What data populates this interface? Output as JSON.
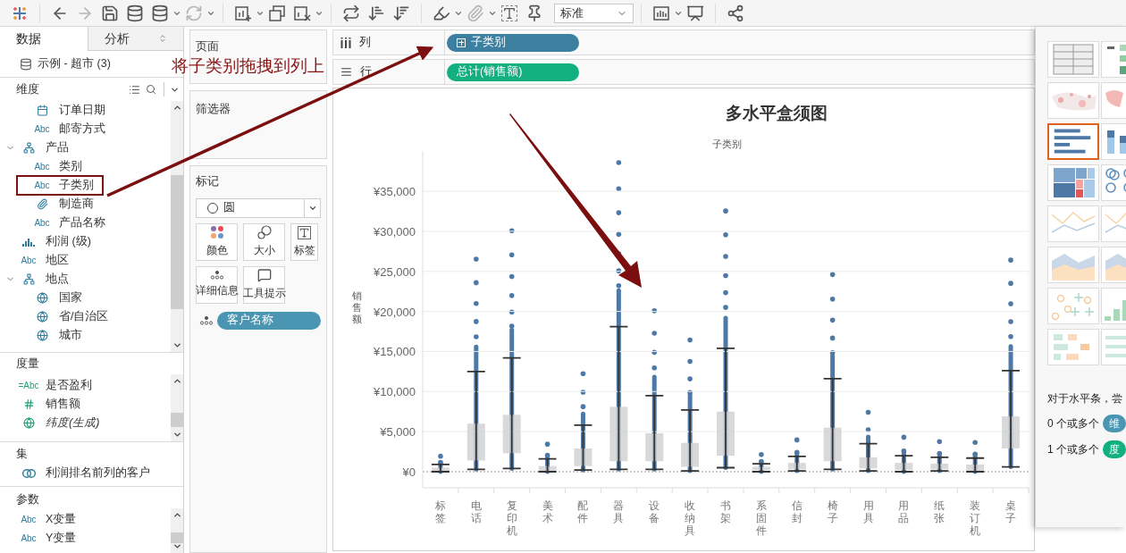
{
  "toolbar": {
    "mark_type_select": {
      "value": "标准"
    }
  },
  "left_panel": {
    "tabs": [
      {
        "label": "数据",
        "selected": true
      },
      {
        "label": "分析",
        "selected": false
      }
    ],
    "data_source": "示例 - 超市 (3)",
    "dimensions": {
      "title": "维度",
      "continued_items": [
        {
          "kind": "date",
          "label": "订单日期",
          "highlighted": false
        },
        {
          "kind": "text",
          "type_label": "Abc",
          "label": "邮寄方式",
          "highlighted": false
        }
      ],
      "items": [
        {
          "kind": "hierarchy",
          "label": "产品",
          "expanded": true,
          "highlighted": false,
          "children": [
            {
              "kind": "text",
              "type_label": "Abc",
              "label": "类别",
              "highlighted": false
            },
            {
              "kind": "text",
              "type_label": "Abc",
              "label": "子类别",
              "highlighted": true
            },
            {
              "kind": "clip",
              "label": "制造商",
              "highlighted": false
            },
            {
              "kind": "text",
              "type_label": "Abc",
              "label": "产品名称",
              "highlighted": false
            }
          ]
        },
        {
          "kind": "bin",
          "label": "利润 (级)",
          "highlighted": false
        },
        {
          "kind": "text",
          "type_label": "Abc",
          "label": "地区",
          "highlighted": false
        },
        {
          "kind": "hierarchy",
          "label": "地点",
          "expanded": true,
          "highlighted": false,
          "children": [
            {
              "kind": "globe",
              "label": "国家",
              "highlighted": false
            },
            {
              "kind": "globe",
              "label": "省/自治区",
              "highlighted": false
            },
            {
              "kind": "globe",
              "label": "城市",
              "highlighted": false
            }
          ]
        }
      ]
    },
    "measures": {
      "title": "度量",
      "items": [
        {
          "kind": "calc_text",
          "type_label": "=Abc",
          "label": "是否盈利"
        },
        {
          "kind": "number",
          "label": "销售额"
        },
        {
          "kind": "generated_globe",
          "label": "纬度(生成)"
        }
      ]
    },
    "sets": {
      "title": "集",
      "items": [
        {
          "kind": "set",
          "label": "利润排名前列的客户"
        }
      ]
    },
    "parameters": {
      "title": "参数",
      "items": [
        {
          "kind": "text",
          "type_label": "Abc",
          "label": "X变量"
        },
        {
          "kind": "text",
          "type_label": "Abc",
          "label": "Y变量"
        }
      ]
    }
  },
  "cards": {
    "pages": {
      "title": "页面"
    },
    "filters": {
      "title": "筛选器"
    },
    "marks": {
      "title": "标记",
      "mark_type": "圆",
      "buttons": [
        {
          "kind": "color",
          "label": "颜色"
        },
        {
          "kind": "size",
          "label": "大小"
        },
        {
          "kind": "label",
          "label": "标签"
        },
        {
          "kind": "detail",
          "label": "详细信息"
        },
        {
          "kind": "tooltip",
          "label": "工具提示"
        }
      ],
      "fields": [
        {
          "kind": "detail",
          "label": "客户名称"
        }
      ]
    }
  },
  "shelves": [
    {
      "kind": "columns",
      "label": "列",
      "pills": [
        {
          "kind": "dimension",
          "label": "子类别",
          "expandable": true
        }
      ]
    },
    {
      "kind": "rows",
      "label": "行",
      "pills": [
        {
          "kind": "measure",
          "label": "总计(销售额)",
          "expandable": false
        }
      ]
    }
  ],
  "view": {
    "chart_data": {
      "type": "candlestick",
      "title": "多水平盒须图",
      "xlabel": "子类别",
      "ylabel": "销售额",
      "categories": [
        "标签",
        "电话",
        "复印机",
        "美术",
        "配件",
        "器具",
        "设备",
        "收纳具",
        "书架",
        "系固件",
        "信封",
        "椅子",
        "用具",
        "用品",
        "纸张",
        "装订机",
        "桌子"
      ],
      "ohlc": [
        [
          100,
          900,
          0,
          500
        ],
        [
          1400,
          12500,
          300,
          6000
        ],
        [
          2300,
          14200,
          400,
          7100
        ],
        [
          100,
          1600,
          0,
          700
        ],
        [
          700,
          5800,
          200,
          2900
        ],
        [
          1300,
          18100,
          300,
          8100
        ],
        [
          1300,
          9500,
          300,
          4800
        ],
        [
          600,
          7700,
          100,
          3600
        ],
        [
          2000,
          15400,
          500,
          7500
        ],
        [
          200,
          1000,
          0,
          600
        ],
        [
          300,
          1900,
          100,
          1100
        ],
        [
          1300,
          11600,
          300,
          5500
        ],
        [
          400,
          3500,
          100,
          1800
        ],
        [
          200,
          2000,
          0,
          1100
        ],
        [
          300,
          1800,
          100,
          1000
        ],
        [
          100,
          1700,
          0,
          900
        ],
        [
          2900,
          12600,
          600,
          6900
        ]
      ],
      "ylim": [
        -2000,
        40000
      ],
      "grid": true,
      "yticks": [
        {
          "value": 0,
          "label": "¥0"
        },
        {
          "value": 5000,
          "label": "¥5,000"
        },
        {
          "value": 10000,
          "label": "¥10,000"
        },
        {
          "value": 15000,
          "label": "¥15,000"
        },
        {
          "value": 20000,
          "label": "¥20,000"
        },
        {
          "value": 25000,
          "label": "¥25,000"
        },
        {
          "value": 30000,
          "label": "¥30,000"
        },
        {
          "value": 35000,
          "label": "¥35,000"
        }
      ]
    }
  },
  "show_me": {
    "charts": [
      {
        "selected": false
      },
      {
        "selected": false
      },
      {
        "selected": false
      },
      {
        "selected": false
      },
      {
        "selected": true
      },
      {
        "selected": false
      },
      {
        "selected": false
      },
      {
        "selected": false
      },
      {
        "selected": false
      },
      {
        "selected": false
      },
      {
        "selected": false
      },
      {
        "selected": false
      },
      {
        "selected": false
      },
      {
        "selected": false
      },
      {
        "selected": false
      },
      {
        "selected": false
      }
    ],
    "hint": "对于水平条，尝",
    "requirements": [
      {
        "text": "0 个或多个",
        "pill": "维",
        "kind": "dimension"
      },
      {
        "text": "1 个或多个",
        "pill": "度",
        "kind": "measure"
      }
    ]
  },
  "annotation": {
    "text": "将子类别拖拽到列上"
  }
}
